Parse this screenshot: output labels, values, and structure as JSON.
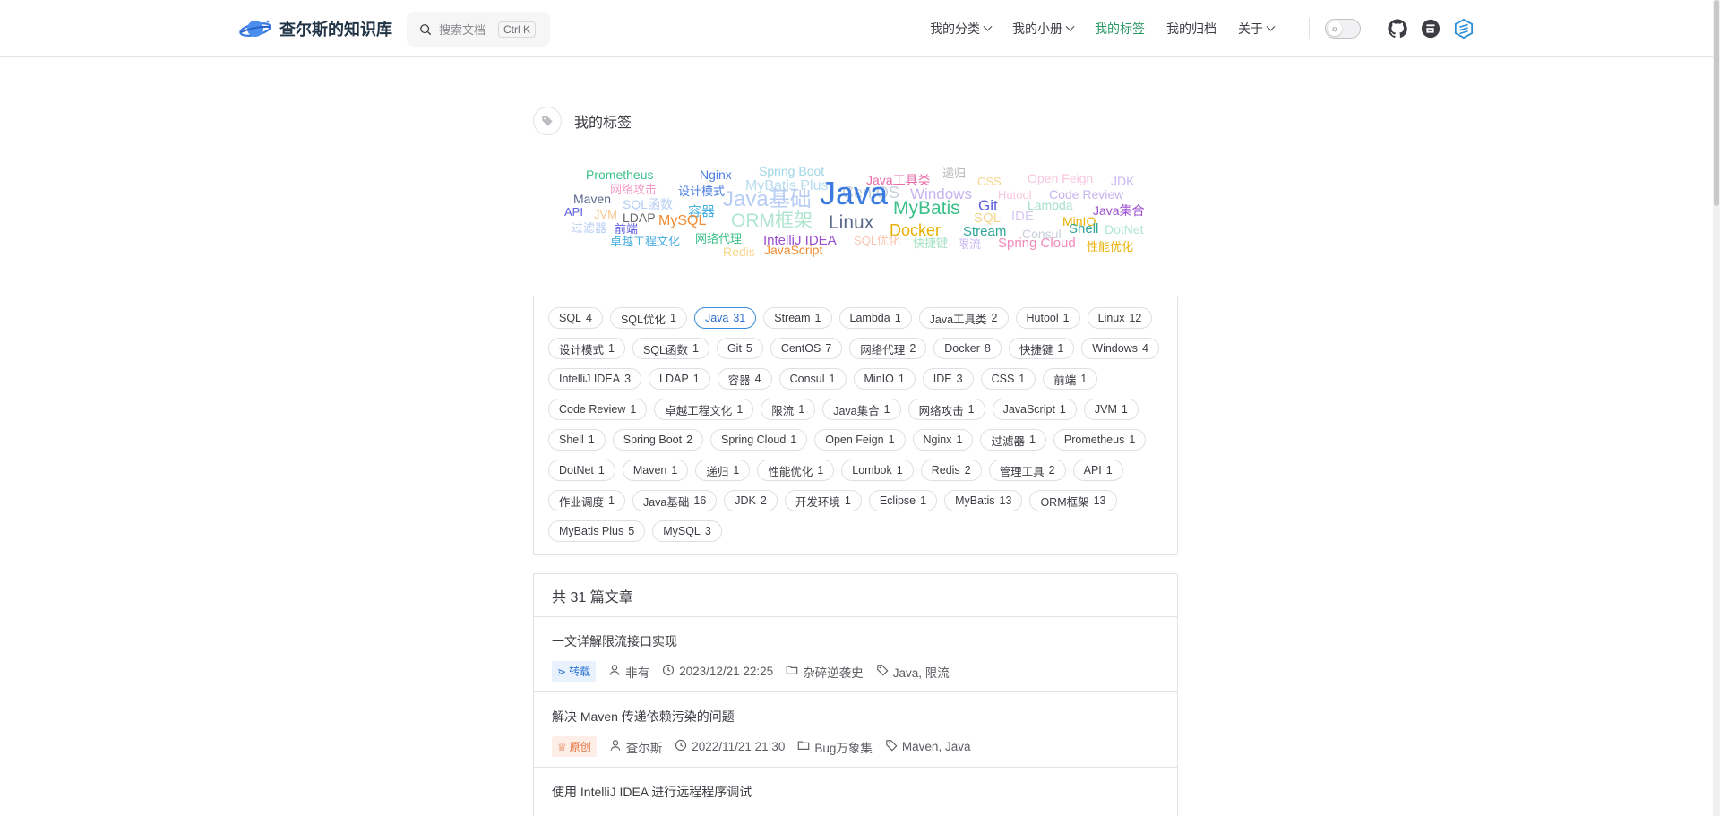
{
  "site": {
    "title": "查尔斯的知识库"
  },
  "search": {
    "placeholder": "搜索文档",
    "shortcut": "Ctrl K"
  },
  "nav": {
    "items": [
      {
        "label": "我的分类",
        "dropdown": true,
        "active": false
      },
      {
        "label": "我的小册",
        "dropdown": true,
        "active": false
      },
      {
        "label": "我的标签",
        "dropdown": false,
        "active": true
      },
      {
        "label": "我的归档",
        "dropdown": false,
        "active": false
      },
      {
        "label": "关于",
        "dropdown": true,
        "active": false
      }
    ],
    "social": [
      "github-icon",
      "gitee-icon",
      "blog-icon"
    ]
  },
  "page": {
    "title": "我的标签"
  },
  "cloud": [
    {
      "t": "Prometheus",
      "c": "#3cc08a"
    },
    {
      "t": "Nginx",
      "c": "#4a7fe0"
    },
    {
      "t": "Spring Boot",
      "c": "#9fd6e6"
    },
    {
      "t": "Java工具类",
      "c": "#e96aa8"
    },
    {
      "t": "递归",
      "c": "#b8b8b8"
    },
    {
      "t": "CSS",
      "c": "#f4d58a"
    },
    {
      "t": "Open Feign",
      "c": "#f8c5dc"
    },
    {
      "t": "JDK",
      "c": "#c6b6f0"
    },
    {
      "t": "网络攻击",
      "c": "#f39bc8"
    },
    {
      "t": "设计模式",
      "c": "#4a7fe0"
    },
    {
      "t": "MyBatis Plus",
      "c": "#b7dcef"
    },
    {
      "t": "Hutool",
      "c": "#f8c5dc"
    },
    {
      "t": "Code Review",
      "c": "#c6b6f0"
    },
    {
      "t": "Maven",
      "c": "#5a6a8a"
    },
    {
      "t": "CentOS",
      "c": "#c7d0da"
    },
    {
      "t": "Windows",
      "c": "#c6b6f0"
    },
    {
      "t": "API",
      "c": "#5d5fe0"
    },
    {
      "t": "SQL函数",
      "c": "#b7cdf3"
    },
    {
      "t": "Java基础",
      "c": "#b7cdf3"
    },
    {
      "t": "Java",
      "c": "#3b7be0"
    },
    {
      "t": "MyBatis",
      "c": "#3cc08a"
    },
    {
      "t": "Git",
      "c": "#5d5fe0"
    },
    {
      "t": "Lambda",
      "c": "#a8e0c8"
    },
    {
      "t": "Java集合",
      "c": "#9b4fd0"
    },
    {
      "t": "JVM",
      "c": "#f6c890"
    },
    {
      "t": "LDAP",
      "c": "#666666"
    },
    {
      "t": "容器",
      "c": "#4ab0e0"
    },
    {
      "t": "SQL",
      "c": "#f4d58a"
    },
    {
      "t": "IDE",
      "c": "#d6c6f0"
    },
    {
      "t": "MinIO",
      "c": "#e8b000"
    },
    {
      "t": "过滤器",
      "c": "#b7cdf3"
    },
    {
      "t": "前端",
      "c": "#5d5fe0"
    },
    {
      "t": "MySQL",
      "c": "#f08a30"
    },
    {
      "t": "ORM框架",
      "c": "#b0e6d0"
    },
    {
      "t": "Linux",
      "c": "#5a6a8a"
    },
    {
      "t": "Docker",
      "c": "#e8b000"
    },
    {
      "t": "Consul",
      "c": "#c7d0da"
    },
    {
      "t": "Shell",
      "c": "#2fa59a"
    },
    {
      "t": "DotNet",
      "c": "#b0e6d0"
    },
    {
      "t": "卓越工程文化",
      "c": "#4ab0e0"
    },
    {
      "t": "网络代理",
      "c": "#3cc08a"
    },
    {
      "t": "IntelliJ IDEA",
      "c": "#9b4fd0"
    },
    {
      "t": "SQL优化",
      "c": "#f8c5b0"
    },
    {
      "t": "快捷键",
      "c": "#a8e0c8"
    },
    {
      "t": "限流",
      "c": "#c6b6f0"
    },
    {
      "t": "Stream",
      "c": "#2fa59a"
    },
    {
      "t": "Spring Cloud",
      "c": "#f08ab8"
    },
    {
      "t": "性能优化",
      "c": "#e8b000"
    },
    {
      "t": "Redis",
      "c": "#f4d58a"
    },
    {
      "t": "JavaScript",
      "c": "#f08a30"
    }
  ],
  "tags": [
    {
      "n": "SQL",
      "c": "4"
    },
    {
      "n": "SQL优化",
      "c": "1"
    },
    {
      "n": "Java",
      "c": "31",
      "active": true
    },
    {
      "n": "Stream",
      "c": "1"
    },
    {
      "n": "Lambda",
      "c": "1"
    },
    {
      "n": "Java工具类",
      "c": "2"
    },
    {
      "n": "Hutool",
      "c": "1"
    },
    {
      "n": "Linux",
      "c": "12"
    },
    {
      "n": "设计模式",
      "c": "1"
    },
    {
      "n": "SQL函数",
      "c": "1"
    },
    {
      "n": "Git",
      "c": "5"
    },
    {
      "n": "CentOS",
      "c": "7"
    },
    {
      "n": "网络代理",
      "c": "2"
    },
    {
      "n": "Docker",
      "c": "8"
    },
    {
      "n": "快捷键",
      "c": "1"
    },
    {
      "n": "Windows",
      "c": "4"
    },
    {
      "n": "IntelliJ IDEA",
      "c": "3"
    },
    {
      "n": "LDAP",
      "c": "1"
    },
    {
      "n": "容器",
      "c": "4"
    },
    {
      "n": "Consul",
      "c": "1"
    },
    {
      "n": "MinIO",
      "c": "1"
    },
    {
      "n": "IDE",
      "c": "3"
    },
    {
      "n": "CSS",
      "c": "1"
    },
    {
      "n": "前端",
      "c": "1"
    },
    {
      "n": "Code Review",
      "c": "1"
    },
    {
      "n": "卓越工程文化",
      "c": "1"
    },
    {
      "n": "限流",
      "c": "1"
    },
    {
      "n": "Java集合",
      "c": "1"
    },
    {
      "n": "网络攻击",
      "c": "1"
    },
    {
      "n": "JavaScript",
      "c": "1"
    },
    {
      "n": "JVM",
      "c": "1"
    },
    {
      "n": "Shell",
      "c": "1"
    },
    {
      "n": "Spring Boot",
      "c": "2"
    },
    {
      "n": "Spring Cloud",
      "c": "1"
    },
    {
      "n": "Open Feign",
      "c": "1"
    },
    {
      "n": "Nginx",
      "c": "1"
    },
    {
      "n": "过滤器",
      "c": "1"
    },
    {
      "n": "Prometheus",
      "c": "1"
    },
    {
      "n": "DotNet",
      "c": "1"
    },
    {
      "n": "Maven",
      "c": "1"
    },
    {
      "n": "递归",
      "c": "1"
    },
    {
      "n": "性能优化",
      "c": "1"
    },
    {
      "n": "Lombok",
      "c": "1"
    },
    {
      "n": "Redis",
      "c": "2"
    },
    {
      "n": "管理工具",
      "c": "2"
    },
    {
      "n": "API",
      "c": "1"
    },
    {
      "n": "作业调度",
      "c": "1"
    },
    {
      "n": "Java基础",
      "c": "16"
    },
    {
      "n": "JDK",
      "c": "2"
    },
    {
      "n": "开发环境",
      "c": "1"
    },
    {
      "n": "Eclipse",
      "c": "1"
    },
    {
      "n": "MyBatis",
      "c": "13"
    },
    {
      "n": "ORM框架",
      "c": "13"
    },
    {
      "n": "MyBatis Plus",
      "c": "5"
    },
    {
      "n": "MySQL",
      "c": "3"
    }
  ],
  "articles": {
    "summary": "共 31 篇文章",
    "items": [
      {
        "title": "一文详解限流接口实现",
        "badge": "转载",
        "badge_type": "repost",
        "author": "非有",
        "date": "2023/12/21 22:25",
        "category": "杂碎逆袭史",
        "tags": "Java, 限流"
      },
      {
        "title": "解决 Maven 传递依赖污染的问题",
        "badge": "原创",
        "badge_type": "orig",
        "author": "查尔斯",
        "date": "2022/11/21 21:30",
        "category": "Bug万象集",
        "tags": "Maven, Java"
      },
      {
        "title": "使用 IntelliJ IDEA 进行远程程序调试",
        "badge": "",
        "badge_type": "",
        "author": "",
        "date": "",
        "category": "",
        "tags": ""
      }
    ]
  },
  "colors": {
    "accent": "#299764",
    "chip_active": "#3a8bd9"
  }
}
